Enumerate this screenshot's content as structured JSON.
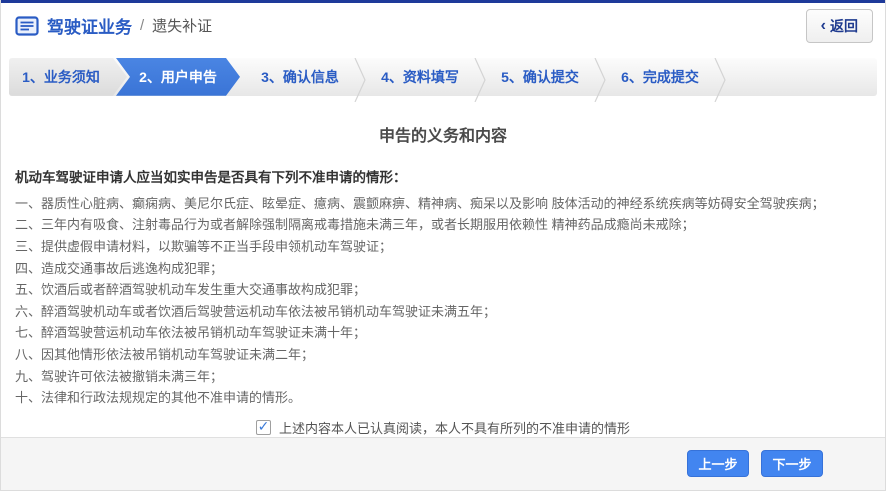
{
  "header": {
    "title": "驾驶证业务",
    "separator": "/",
    "subtitle": "遗失补证",
    "back_chevron": "‹",
    "back_label": "返回"
  },
  "steps": [
    {
      "label": "1、业务须知",
      "_class": "step-first"
    },
    {
      "label": "2、用户申告",
      "_class": "step-active"
    },
    {
      "label": "3、确认信息",
      "_class": "step-plain"
    },
    {
      "label": "4、资料填写",
      "_class": "step-plain step-sep"
    },
    {
      "label": "5、确认提交",
      "_class": "step-plain step-sep"
    },
    {
      "label": "6、完成提交",
      "_class": "step-plain step-sep"
    },
    {
      "label": "",
      "_class": "step-plain step-sep step-filler"
    }
  ],
  "content": {
    "title": "申告的义务和内容",
    "intro": "机动车驾驶证申请人应当如实申告是否具有下列不准申请的情形：",
    "items": [
      "一、器质性心脏病、癫痫病、美尼尔氏症、眩晕症、癔病、震颤麻痹、精神病、痴呆以及影响 肢体活动的神经系统疾病等妨碍安全驾驶疾病；",
      "二、三年内有吸食、注射毒品行为或者解除强制隔离戒毒措施未满三年，或者长期服用依赖性 精神药品成瘾尚未戒除；",
      "三、提供虚假申请材料，以欺骗等不正当手段申领机动车驾驶证；",
      "四、造成交通事故后逃逸构成犯罪；",
      "五、饮酒后或者醉酒驾驶机动车发生重大交通事故构成犯罪；",
      "六、醉酒驾驶机动车或者饮酒后驾驶营运机动车依法被吊销机动车驾驶证未满五年；",
      "七、醉酒驾驶营运机动车依法被吊销机动车驾驶证未满十年；",
      "八、因其他情形依法被吊销机动车驾驶证未满二年；",
      "九、驾驶许可依法被撤销未满三年；",
      "十、法律和行政法规规定的其他不准申请的情形。"
    ],
    "checkbox": {
      "checked": true,
      "tick": "✓",
      "label": "上述内容本人已认真阅读，本人不具有所列的不准申请的情形"
    }
  },
  "footer": {
    "prev_label": "上一步",
    "next_label": "下一步"
  },
  "colors": {
    "topbar_blue": "#1e3a9a",
    "brand_blue": "#2a5cc4",
    "active_step_blue": "#3d7ddf",
    "button_blue": "#4285f0",
    "text_gray": "#666666",
    "footer_gray": "#f5f5f5"
  }
}
